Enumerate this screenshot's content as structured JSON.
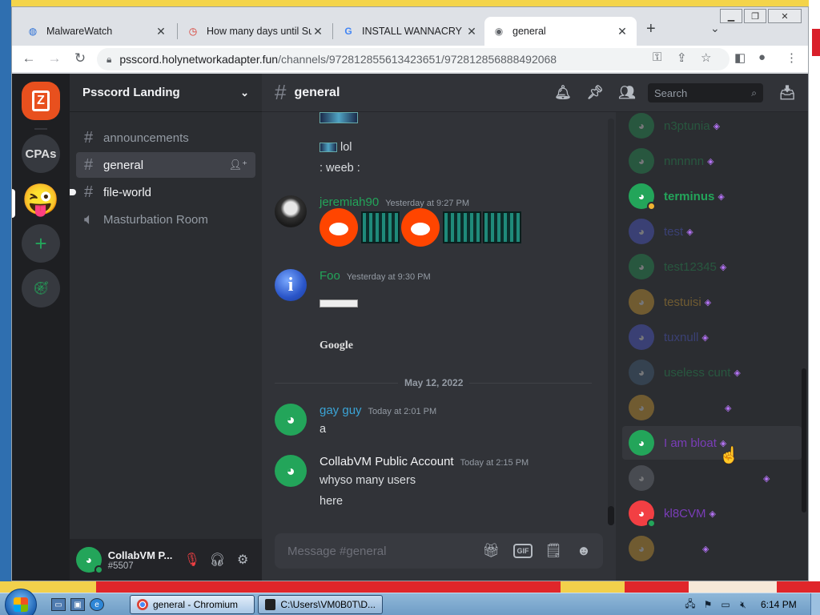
{
  "browser": {
    "tabs": [
      {
        "title": "MalwareWatch",
        "favicon": "malwarewatch-favicon",
        "active": false
      },
      {
        "title": "How many days until Su",
        "favicon": "clock-favicon",
        "active": false
      },
      {
        "title": "INSTALL WANNACRY FR",
        "favicon": "google-favicon",
        "active": false
      },
      {
        "title": "general",
        "favicon": "globe-favicon",
        "active": true
      }
    ],
    "url_host": "psscord.holynetworkadapter.fun",
    "url_path": "/channels/972812855613423651/972812856888492068",
    "new_tab_symbol": "+",
    "tab_list_symbol": "⌄"
  },
  "guilds": {
    "cpas_label": "CPAs"
  },
  "server": {
    "name": "Psscord Landing",
    "channels": [
      {
        "name": "announcements",
        "type": "text",
        "state": "normal"
      },
      {
        "name": "general",
        "type": "text",
        "state": "active"
      },
      {
        "name": "file-world",
        "type": "text",
        "state": "unread"
      },
      {
        "name": "Masturbation Room",
        "type": "voice",
        "state": "normal"
      }
    ]
  },
  "user": {
    "name": "CollabVM P...",
    "tag": "#5507"
  },
  "chat": {
    "channel": "general",
    "search_placeholder": "Search",
    "composer_placeholder": "Message #general",
    "gif_label": "GIF",
    "messages": {
      "lol": "lol",
      "weeb": ": weeb :",
      "jeremiah_author": "jeremiah90",
      "jeremiah_time": "Yesterday at 9:27 PM",
      "foo_author": "Foo",
      "foo_time": "Yesterday at 9:30 PM",
      "google_text": "Google",
      "date_divider": "May 12, 2022",
      "gayguy_author": "gay guy",
      "gayguy_time": "Today at 2:01 PM",
      "gayguy_text": "a",
      "collab_author": "CollabVM Public Account",
      "collab_time": "Today at 2:15 PM",
      "collab_text1": "whyso many users",
      "collab_text2": "here"
    }
  },
  "members": [
    {
      "name": "n3ptunia",
      "color": "#23a55a",
      "dim": true
    },
    {
      "name": "nnnnnn",
      "color": "#23a55a",
      "dim": true
    },
    {
      "name": "terminus",
      "color": "#23a55a",
      "dim": false
    },
    {
      "name": "test",
      "color": "#5865f2",
      "dim": true
    },
    {
      "name": "test12345",
      "color": "#23a55a",
      "dim": true
    },
    {
      "name": "testuisi",
      "color": "#f0b232",
      "dim": true
    },
    {
      "name": "tuxnull",
      "color": "#5865f2",
      "dim": true
    },
    {
      "name": "useless cunt",
      "color": "#23a55a",
      "dim": true
    },
    {
      "name": "",
      "color": "#f0b232",
      "dim": true
    },
    {
      "name": "I am bloat",
      "color": "#b473f5",
      "dim": false
    },
    {
      "name": "",
      "color": "#80848e",
      "dim": true
    },
    {
      "name": "kl8CVM",
      "color": "#b473f5",
      "dim": false
    },
    {
      "name": "",
      "color": "#f0b232",
      "dim": true
    }
  ],
  "taskbar": {
    "chromium_label": "general - Chromium",
    "cmd_label": "C:\\Users\\VM0B0T\\D...",
    "clock": "6:14 PM"
  },
  "colors": {
    "discord_bg": "#313338",
    "sidebar_bg": "#2b2d31",
    "guild_bg": "#1e1f22",
    "accent_green": "#23a55a",
    "jeremiah_color": "#23a55a",
    "foo_color": "#23a55a",
    "gayguy_color": "#3ba4d6",
    "collab_color": "#f2f3f5"
  }
}
